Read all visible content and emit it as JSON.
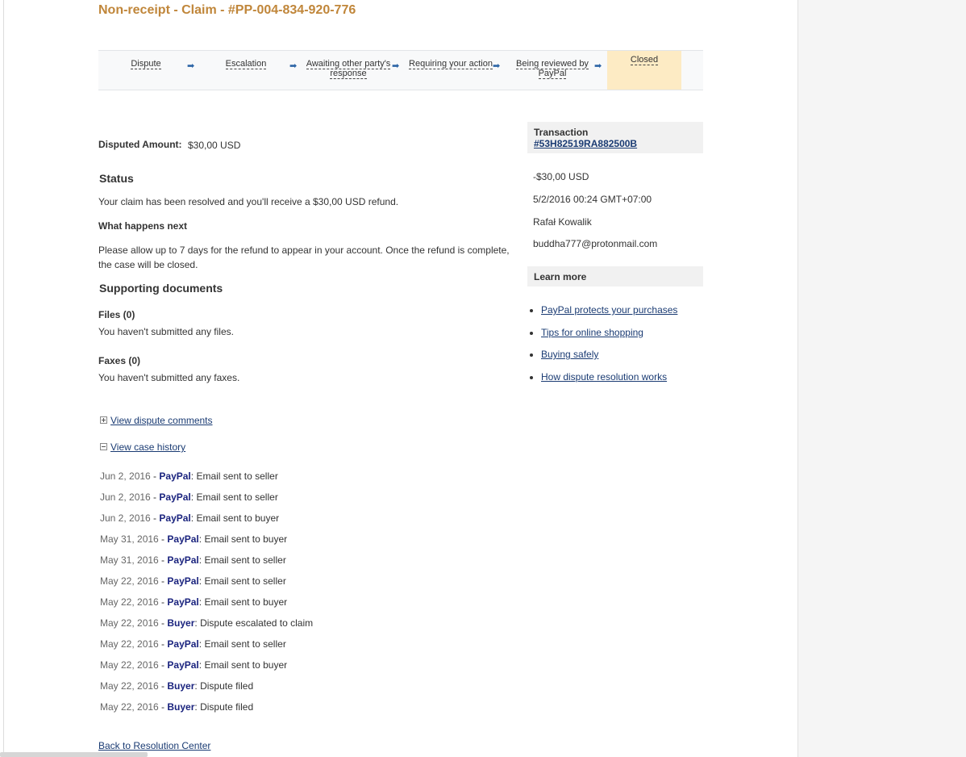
{
  "page": {
    "title": "Non-receipt - Claim - #PP-004-834-920-776"
  },
  "steps": [
    {
      "label_1": "Dispute",
      "label_2": ""
    },
    {
      "label_1": "Escalation",
      "label_2": ""
    },
    {
      "label_1": "Awaiting other party's",
      "label_2": "response"
    },
    {
      "label_1": "Requiring your action",
      "label_2": ""
    },
    {
      "label_1": "Being reviewed by",
      "label_2": "PayPal"
    },
    {
      "label_1": "Closed",
      "label_2": ""
    }
  ],
  "active_step": "Closed",
  "arrow_glyph": "➡",
  "dispute": {
    "amount_label": "Disputed Amount:",
    "amount_value": "$30,00 USD"
  },
  "status": {
    "heading": "Status",
    "message": "Your claim has been resolved and you'll receive a $30,00 USD refund.",
    "next_heading": "What happens next",
    "next_line_1": "Please allow up to 7 days for the refund to appear in your account. Once the refund is complete,",
    "next_line_2": "the case will be closed."
  },
  "documents": {
    "heading": "Supporting documents",
    "files_label": "Files (0)",
    "files_text": "You haven't submitted any files.",
    "faxes_label": "Faxes (0)",
    "faxes_text": "You haven't submitted any faxes."
  },
  "links": {
    "view_comments": "View dispute comments",
    "view_history": "View case history",
    "back": "Back to Resolution Center"
  },
  "history": [
    {
      "date": "Jun 2, 2016",
      "actor": "PayPal",
      "event": "Email sent to seller"
    },
    {
      "date": "Jun 2, 2016",
      "actor": "PayPal",
      "event": "Email sent to seller"
    },
    {
      "date": "Jun 2, 2016",
      "actor": "PayPal",
      "event": "Email sent to buyer"
    },
    {
      "date": "May 31, 2016",
      "actor": "PayPal",
      "event": "Email sent to buyer"
    },
    {
      "date": "May 31, 2016",
      "actor": "PayPal",
      "event": "Email sent to seller"
    },
    {
      "date": "May 22, 2016",
      "actor": "PayPal",
      "event": "Email sent to seller"
    },
    {
      "date": "May 22, 2016",
      "actor": "PayPal",
      "event": "Email sent to buyer"
    },
    {
      "date": "May 22, 2016",
      "actor": "Buyer",
      "event": "Dispute escalated to claim"
    },
    {
      "date": "May 22, 2016",
      "actor": "PayPal",
      "event": "Email sent to seller"
    },
    {
      "date": "May 22, 2016",
      "actor": "PayPal",
      "event": "Email sent to buyer"
    },
    {
      "date": "May 22, 2016",
      "actor": "Buyer",
      "event": "Dispute filed"
    },
    {
      "date": "May 22, 2016",
      "actor": "Buyer",
      "event": "Dispute filed"
    }
  ],
  "transaction": {
    "heading": "Transaction",
    "id": "#53H82519RA882500B",
    "amount": "-$30,00 USD",
    "datetime": "5/2/2016 00:24 GMT+07:00",
    "name": "Rafał Kowalik",
    "email": "buddha777@protonmail.com"
  },
  "learn_more": {
    "heading": "Learn more",
    "items": [
      "PayPal protects your purchases",
      "Tips for online shopping",
      "Buying safely",
      "How dispute resolution works"
    ]
  },
  "colors": {
    "title": "#c0863a",
    "link": "#1a3b73",
    "actor": "#1a237e",
    "active_step": "#fdebc4"
  }
}
